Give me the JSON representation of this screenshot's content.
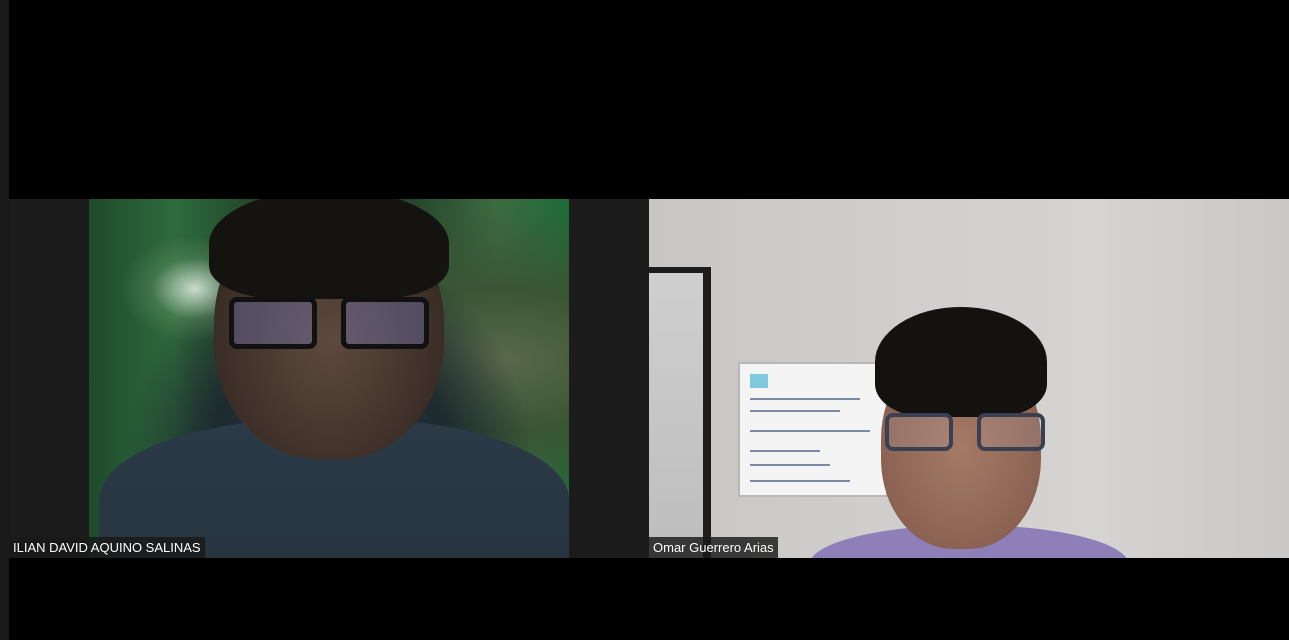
{
  "meeting": {
    "layout": "gallery",
    "participants": [
      {
        "name": "ILIAN DAVID AQUINO SALINAS",
        "video": "on"
      },
      {
        "name": "Omar Guerrero Arias",
        "video": "on"
      }
    ]
  },
  "colors": {
    "background": "#000000",
    "tile_background": "#1c1c1c",
    "name_label_bg": "#181818",
    "name_label_text": "#ffffff"
  }
}
